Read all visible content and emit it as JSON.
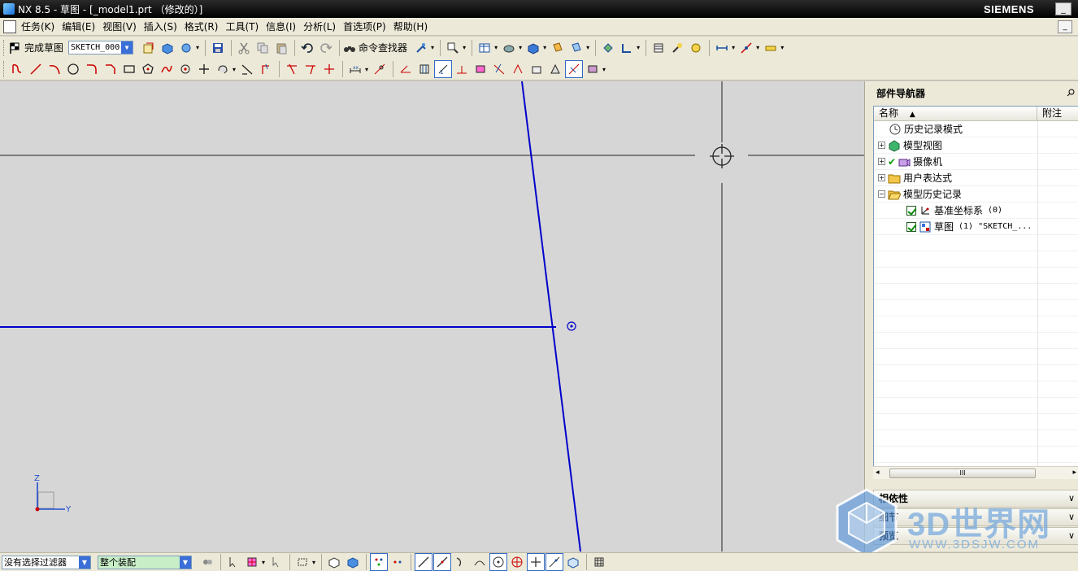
{
  "window": {
    "title": "NX 8.5 - 草图 - [_model1.prt （修改的）]",
    "brand": "SIEMENS",
    "minimize": "_",
    "mdi_minimize": "_",
    "mdi_restore": "□"
  },
  "menu": {
    "items": [
      "任务(K)",
      "编辑(E)",
      "视图(V)",
      "插入(S)",
      "格式(R)",
      "工具(T)",
      "信息(I)",
      "分析(L)",
      "首选项(P)",
      "帮助(H)"
    ]
  },
  "toolbar": {
    "finish_sketch": "完成草图",
    "sketch_name": "SKETCH_000",
    "command_finder": "命令查找器"
  },
  "graphics": {
    "background": "#d6d6d6",
    "line_color": "#0000cc",
    "axis_labels": {
      "z": "Z",
      "y": "Y"
    }
  },
  "navigator": {
    "title": "部件导航器",
    "col_name": "名称",
    "col_note": "附注",
    "nodes": [
      {
        "label": "历史记录模式",
        "icon": "clock-icon"
      },
      {
        "label": "模型视图",
        "icon": "model-views-icon"
      },
      {
        "label": "摄像机",
        "icon": "camera-icon"
      },
      {
        "label": "用户表达式",
        "icon": "folder-icon"
      },
      {
        "label": "模型历史记录",
        "icon": "folder-icon"
      },
      {
        "label": "基准坐标系",
        "suffix": "(0)",
        "icon": "datum-csys-icon"
      },
      {
        "label": "草图",
        "suffix": "(1) \"SKETCH_...",
        "icon": "sketch-icon"
      }
    ],
    "sections": [
      "相依性",
      "细节",
      "预览"
    ]
  },
  "watermark": {
    "text": "3D世界网",
    "sub": "WWW.3DSJW.COM"
  },
  "status": {
    "filter": "没有选择过滤器",
    "scope": "整个装配"
  }
}
